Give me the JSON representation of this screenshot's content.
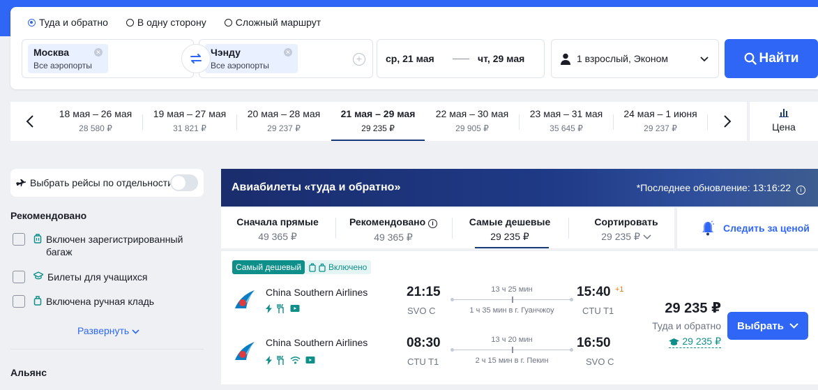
{
  "trip_types": [
    {
      "label": "Туда и обратно",
      "selected": true
    },
    {
      "label": "В одну сторону",
      "selected": false
    },
    {
      "label": "Сложный маршрут",
      "selected": false
    }
  ],
  "origin": {
    "city": "Москва",
    "airports": "Все аэропорты"
  },
  "destination": {
    "city": "Чэнду",
    "airports": "Все аэропорты"
  },
  "dates": {
    "depart": "ср, 21 мая",
    "return": "чт, 29 мая"
  },
  "passengers": "1 взрослый, Эконом",
  "search_button": "Найти",
  "date_options": [
    {
      "range": "18 мая – 26 мая",
      "price": "28 580 ₽",
      "active": false
    },
    {
      "range": "19 мая – 27 мая",
      "price": "31 821 ₽",
      "active": false
    },
    {
      "range": "20 мая – 28 мая",
      "price": "29 237 ₽",
      "active": false
    },
    {
      "range": "21 мая – 29 мая",
      "price": "29 235 ₽",
      "active": true
    },
    {
      "range": "22 мая – 30 мая",
      "price": "29 905 ₽",
      "active": false
    },
    {
      "range": "23 мая – 31 мая",
      "price": "35 645 ₽",
      "active": false
    },
    {
      "range": "24 мая – 1 июня",
      "price": "29 237 ₽",
      "active": false
    }
  ],
  "price_chart_label": "Цена",
  "sidebar": {
    "separate_flights": "Выбрать рейсы по отдельности",
    "recommended_title": "Рекомендовано",
    "filters": [
      {
        "label": "Включен зарегистрированный багаж",
        "icon": "baggage-icon"
      },
      {
        "label": "Билеты для учащихся",
        "icon": "graduation-cap-icon"
      },
      {
        "label": "Включена ручная кладь",
        "icon": "carry-on-icon"
      }
    ],
    "expand": "Развернуть",
    "alliance_title": "Альянс"
  },
  "results": {
    "title": "Авиабилеты «туда и обратно»",
    "last_update": "*Последнее обновление: 13:16:22"
  },
  "sort_tabs": [
    {
      "label": "Сначала прямые",
      "value": "49 365 ₽",
      "active": false
    },
    {
      "label": "Рекомендовано",
      "value": "49 365 ₽",
      "active": false
    },
    {
      "label": "Самые дешевые",
      "value": "29 235 ₽",
      "active": true
    },
    {
      "label": "Сортировать",
      "value": "29 235 ₽",
      "active": false
    }
  ],
  "watch_price": "Следить за ценой",
  "ticket": {
    "badge_cheapest": "Самый дешевый",
    "badge_included": "Включено",
    "legs": [
      {
        "airline": "China Southern Airlines",
        "dep_time": "21:15",
        "dep_code": "SVO C",
        "duration": "13 ч 25 мин",
        "stop": "1 ч 35 мин в г. Гуанчжоу",
        "arr_time": "15:40",
        "arr_code": "CTU T1",
        "day_offset": "+1"
      },
      {
        "airline": "China Southern Airlines",
        "dep_time": "08:30",
        "dep_code": "CTU T1",
        "duration": "13 ч 20 мин",
        "stop": "2 ч 15 мин в г. Пекин",
        "arr_time": "16:50",
        "arr_code": "SVO C",
        "day_offset": ""
      }
    ],
    "price": "29 235 ₽",
    "price_note": "Туда и обратно",
    "student_price": "29 235 ₽",
    "select_button": "Выбрать"
  },
  "colors": {
    "accent": "#2f66f5",
    "teal": "#0f8f8a",
    "header_dark": "#1a2d6d",
    "orange": "#e07a15"
  }
}
